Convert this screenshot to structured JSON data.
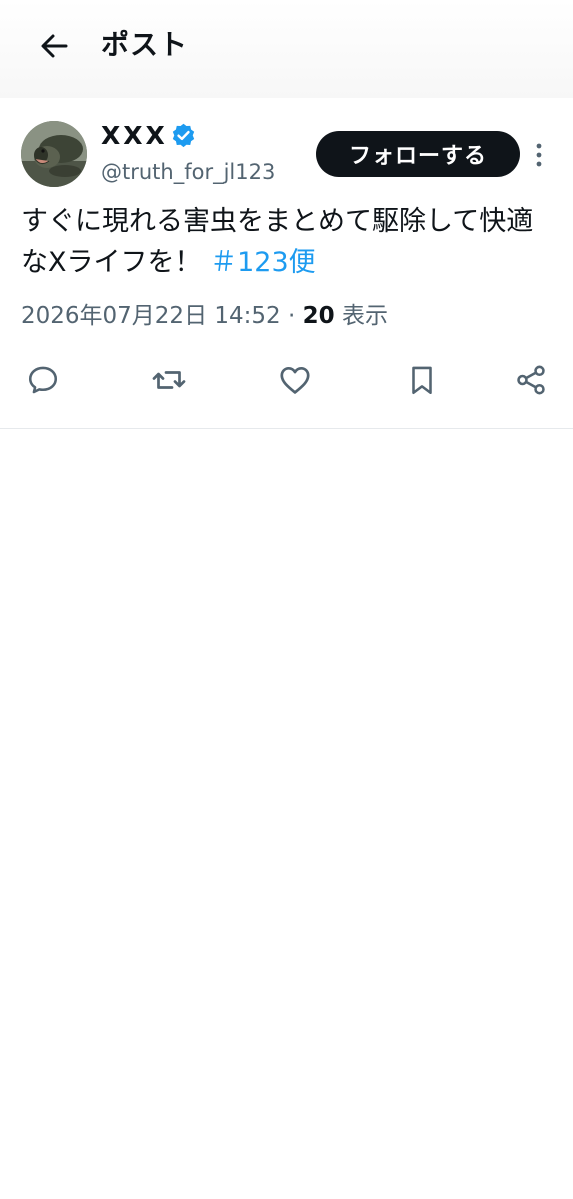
{
  "header": {
    "title": "ポスト"
  },
  "post": {
    "display_name": "XXX",
    "handle": "@truth_for_jl123",
    "follow_label": "フォローする",
    "text": "すぐに現れる害虫をまとめて駆除して快適なXライフを！",
    "hashtag": "＃123便",
    "timestamp": "2026年07月22日 14:52",
    "separator": "·",
    "views_count": "20",
    "views_label": "表示"
  },
  "icons": {
    "back": "arrow-left-icon",
    "verified": "verified-badge-icon",
    "more": "more-vertical-icon",
    "reply": "reply-icon",
    "repost": "repost-icon",
    "like": "heart-icon",
    "bookmark": "bookmark-icon",
    "share": "share-icon"
  },
  "colors": {
    "text": "#0f1419",
    "secondary": "#536471",
    "accent": "#1d9bf0",
    "verified": "#1d9bf0",
    "follow_bg": "#0f1419"
  }
}
